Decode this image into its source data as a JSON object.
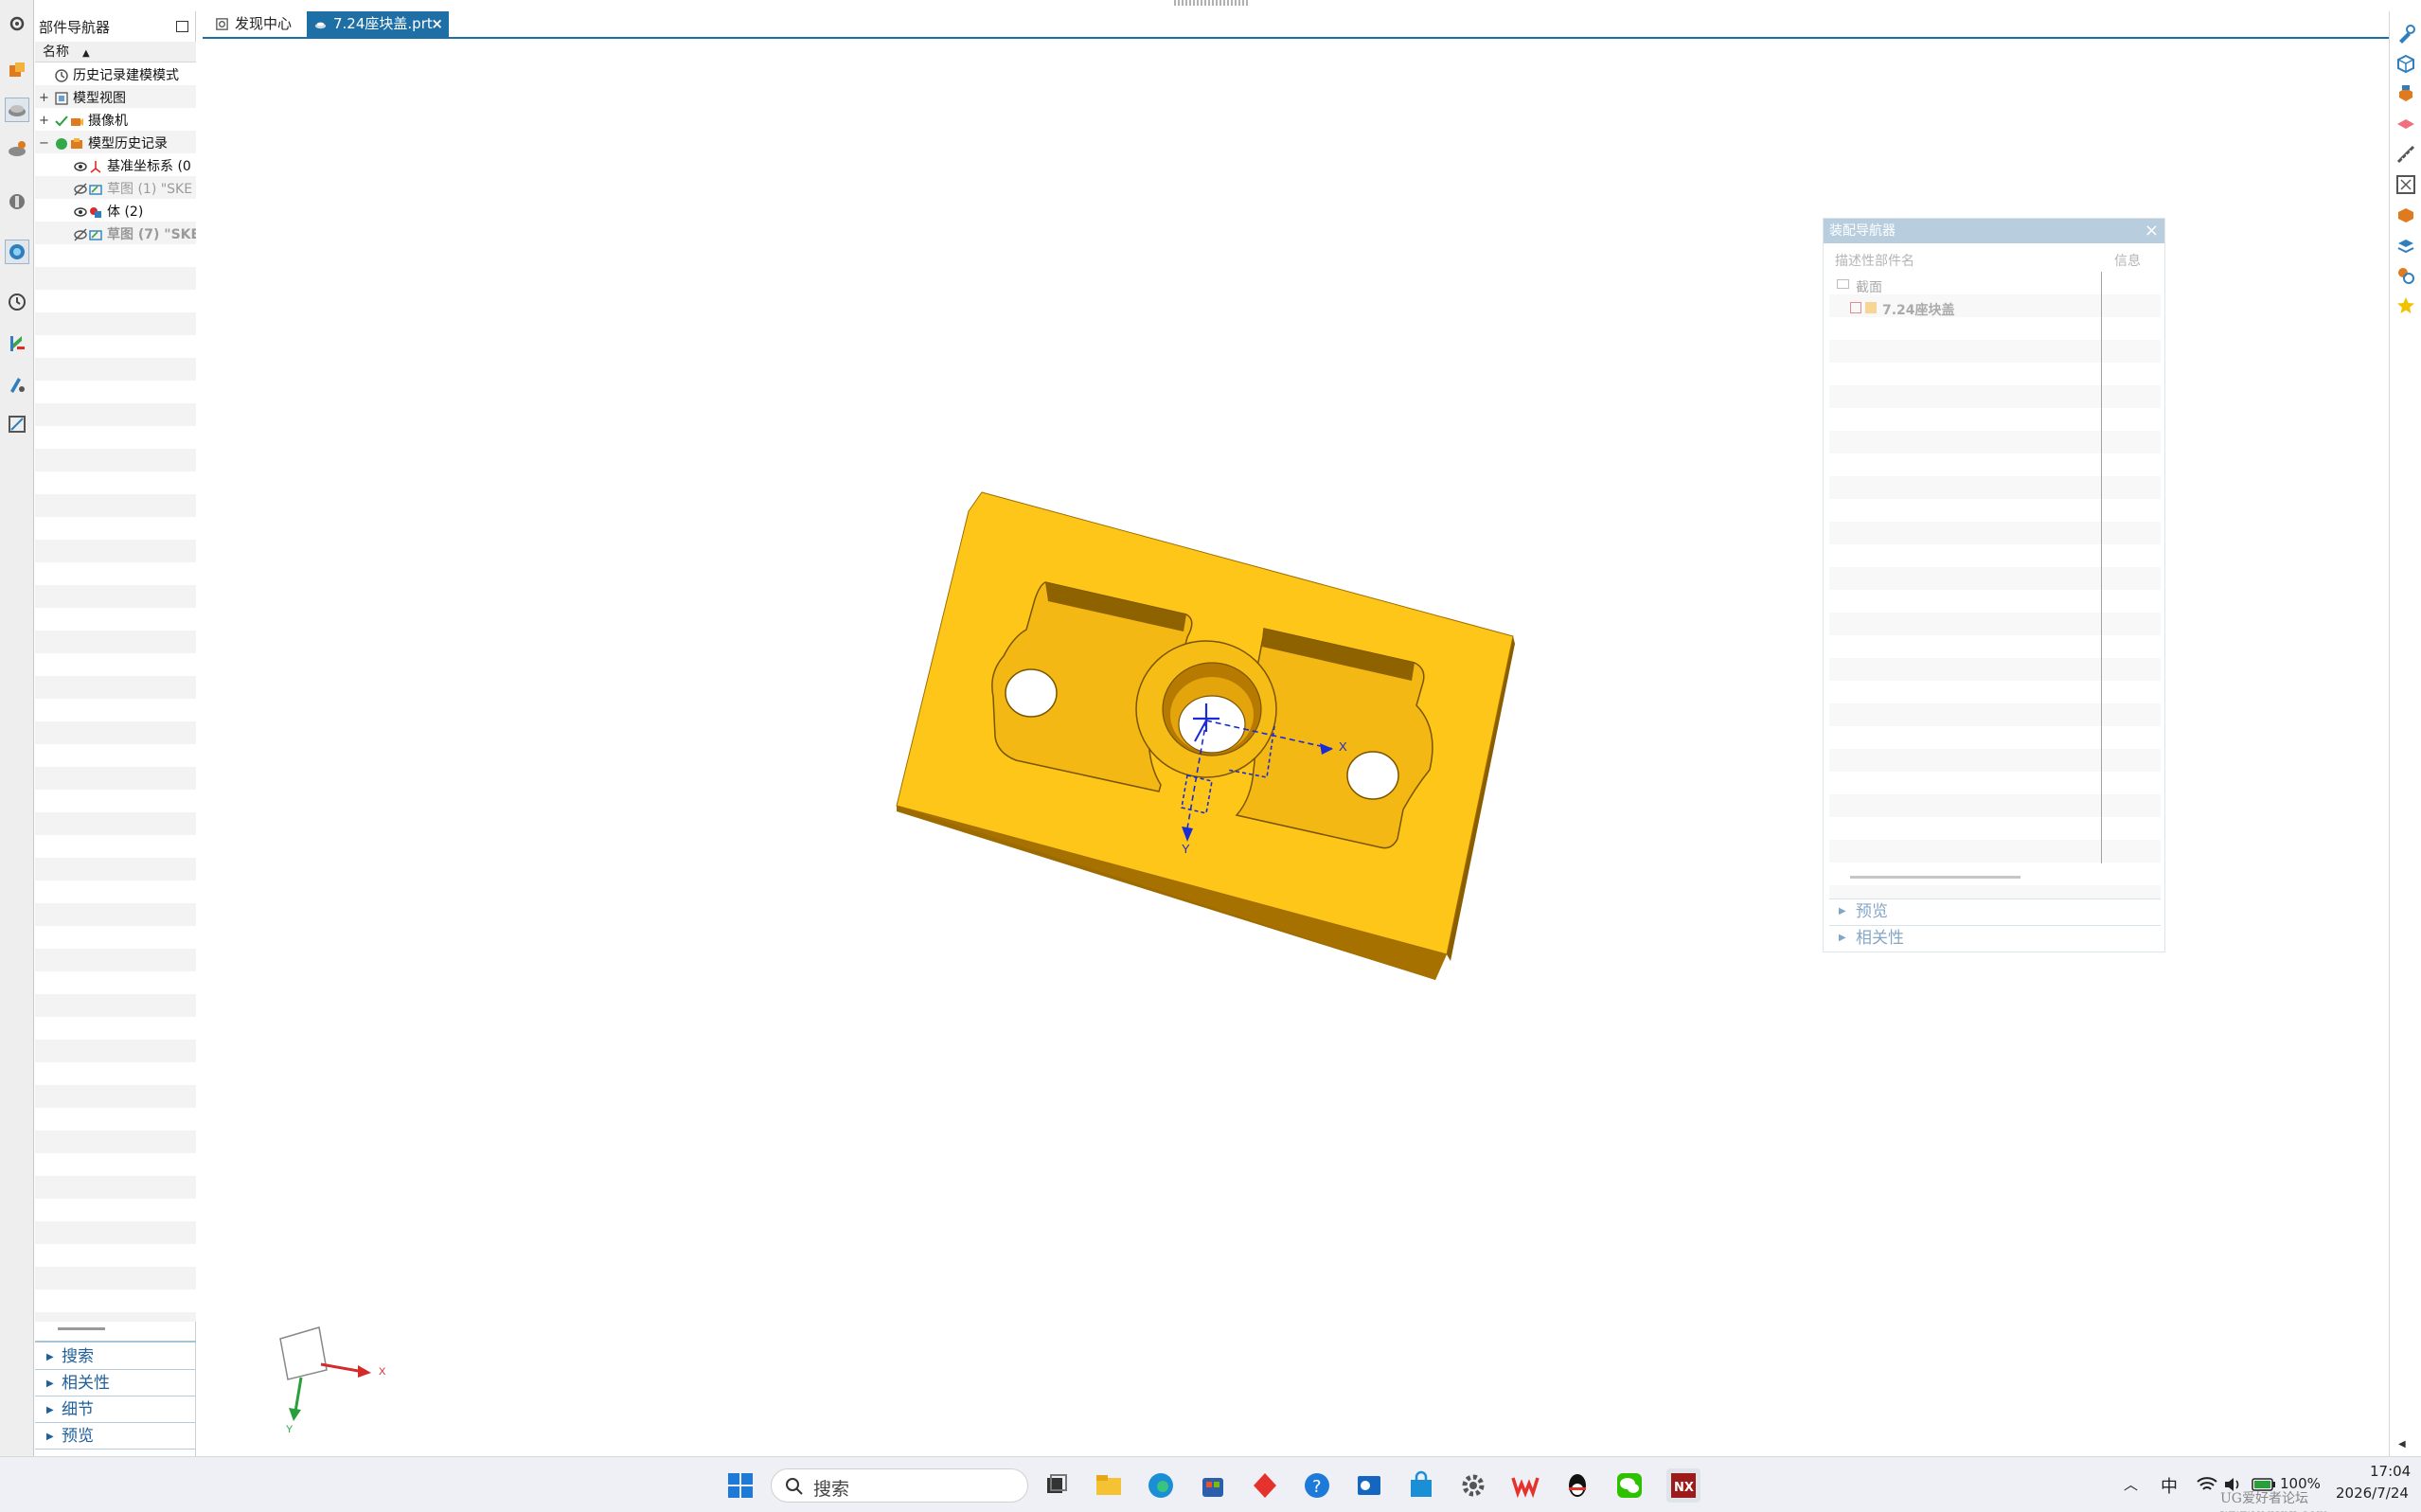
{
  "part_navigator": {
    "title": "部件导航器",
    "column_name": "名称",
    "rows": [
      {
        "label": "历史记录建模模式"
      },
      {
        "label": "模型视图"
      },
      {
        "label": "摄像机"
      },
      {
        "label": "模型历史记录"
      },
      {
        "label": "基准坐标系 (0"
      },
      {
        "label": "草图 (1) \"SKE"
      },
      {
        "label": "体 (2)"
      },
      {
        "label": "草图 (7) \"SKE"
      }
    ],
    "sections": [
      "搜索",
      "相关性",
      "细节",
      "预览"
    ]
  },
  "tabs": [
    {
      "label": "发现中心"
    },
    {
      "label": "7.24座块盖.prt"
    }
  ],
  "close_glyph": "×",
  "assembly_navigator": {
    "title": "装配导航器",
    "col_name": "描述性部件名",
    "col_info": "信息",
    "rows": [
      {
        "label": "截面"
      },
      {
        "label": "7.24座块盖"
      }
    ],
    "sections": [
      "预览",
      "相关性"
    ]
  },
  "viewport": {
    "csys_x_label": "X",
    "csys_y_label": "Y",
    "triad_x_label": "X",
    "triad_y_label": "Y"
  },
  "taskbar": {
    "search_label": "搜索",
    "ime": "中",
    "battery": "100%",
    "time": "17:04",
    "date": "2026/7/24",
    "watermark": "UG爱好者论坛 www.ugsnx.com"
  },
  "colors": {
    "part_top": "#fdc618",
    "part_side_front": "#a06e00",
    "part_side_left": "#c68c08",
    "accent": "#1d6fa5"
  }
}
